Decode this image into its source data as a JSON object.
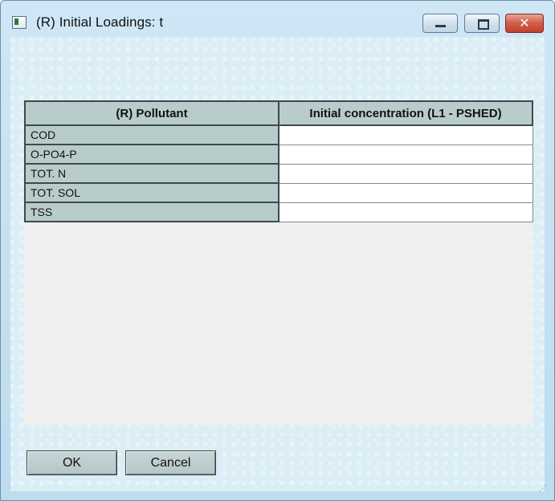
{
  "window": {
    "title": "(R) Initial Loadings: t",
    "controls": {
      "minimize": "minimize",
      "maximize": "maximize",
      "close": "close"
    }
  },
  "grid": {
    "headers": [
      "(R) Pollutant",
      "Initial concentration (L1 - PSHED)"
    ],
    "rows": [
      {
        "pollutant": "COD",
        "value": ""
      },
      {
        "pollutant": "O-PO4-P",
        "value": ""
      },
      {
        "pollutant": "TOT. N",
        "value": ""
      },
      {
        "pollutant": "TOT. SOL",
        "value": ""
      },
      {
        "pollutant": "TSS",
        "value": ""
      }
    ]
  },
  "buttons": {
    "ok": "OK",
    "cancel": "Cancel"
  },
  "colors": {
    "frame": "#cfe6f5",
    "header_cell": "#b9cccc",
    "close_button": "#c2412a",
    "grid_background": "#efefef"
  }
}
